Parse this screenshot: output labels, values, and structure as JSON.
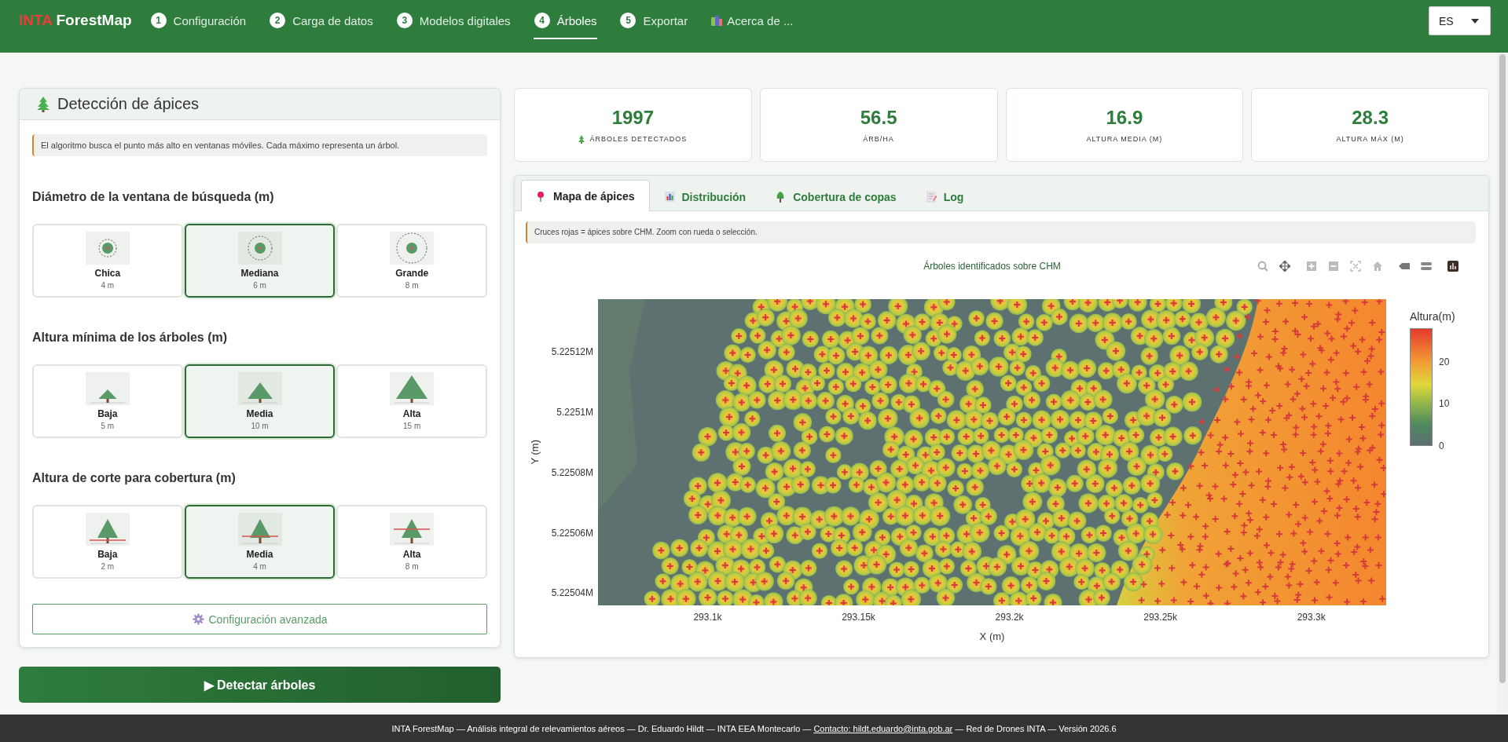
{
  "header": {
    "brand_prefix": "INTA",
    "brand_name": "ForestMap",
    "language": "ES",
    "nav": [
      {
        "kind": "step",
        "number": "1",
        "label": "Configuración",
        "selected": false
      },
      {
        "kind": "step",
        "number": "2",
        "label": "Carga de datos",
        "selected": false
      },
      {
        "kind": "step",
        "number": "3",
        "label": "Modelos digitales",
        "selected": false
      },
      {
        "kind": "step",
        "number": "4",
        "label": "Árboles",
        "selected": true
      },
      {
        "kind": "step",
        "number": "5",
        "label": "Exportar",
        "selected": false
      },
      {
        "kind": "about",
        "label": "Acerca de ...",
        "selected": false
      }
    ]
  },
  "detection_panel": {
    "title": "Detección de ápices",
    "info": "El algoritmo busca el punto más alto en ventanas móviles. Cada máximo representa un árbol.",
    "groups": [
      {
        "title": "Diámetro de la ventana de búsqueda (m)",
        "kind": "window",
        "options": [
          {
            "label": "Chica",
            "value": "4 m",
            "selected": false
          },
          {
            "label": "Mediana",
            "value": "6 m",
            "selected": true
          },
          {
            "label": "Grande",
            "value": "8 m",
            "selected": false
          }
        ]
      },
      {
        "title": "Altura mínima de los árboles (m)",
        "kind": "height",
        "options": [
          {
            "label": "Baja",
            "value": "5 m",
            "selected": false
          },
          {
            "label": "Media",
            "value": "10 m",
            "selected": true
          },
          {
            "label": "Alta",
            "value": "15 m",
            "selected": false
          }
        ]
      },
      {
        "title": "Altura de corte para cobertura (m)",
        "kind": "cut",
        "options": [
          {
            "label": "Baja",
            "value": "2 m",
            "selected": false
          },
          {
            "label": "Media",
            "value": "4 m",
            "selected": true
          },
          {
            "label": "Alta",
            "value": "8 m",
            "selected": false
          }
        ]
      }
    ],
    "advanced_button": "Configuración avanzada"
  },
  "detect_button": "▶ Detectar árboles",
  "stats": [
    {
      "value": "1997",
      "label": "ÁRBOLES DETECTADOS",
      "kind": "tree"
    },
    {
      "value": "56.5",
      "label": "ÁRB/HA",
      "kind": "plain"
    },
    {
      "value": "16.9",
      "label": "ALTURA MEDIA (M)",
      "kind": "plain"
    },
    {
      "value": "28.3",
      "label": "ALTURA MÁX (M)",
      "kind": "plain"
    }
  ],
  "tabs": [
    {
      "label": "Mapa de ápices",
      "kind": "pin",
      "selected": true
    },
    {
      "label": "Distribución",
      "kind": "chart",
      "selected": false
    },
    {
      "label": "Cobertura de copas",
      "kind": "tree",
      "selected": false
    },
    {
      "label": "Log",
      "kind": "memo",
      "selected": false
    }
  ],
  "map": {
    "hint": "Cruces rojas = ápices sobre CHM. Zoom con rueda o selección.",
    "title": "Árboles identificados sobre CHM",
    "xlabel": "X (m)",
    "ylabel": "Y (m)",
    "xticks": [
      "293.1k",
      "293.15k",
      "293.2k",
      "293.25k",
      "293.3k"
    ],
    "yticks": [
      "5.22512M",
      "5.2251M",
      "5.22508M",
      "5.22506M",
      "5.22504M"
    ],
    "colorbar": {
      "title": "Altura(m)",
      "ticks": [
        "20",
        "10",
        "0"
      ]
    }
  },
  "footer": {
    "text_before": "INTA ForestMap — Análisis integral de relevamientos aéreos — Dr. Eduardo Hildt — INTA EEA Montecarlo — ",
    "link": "Contacto: hildt.eduardo@inta.gob.ar",
    "text_after": " — Red de Drones INTA — Versión 2026.6"
  }
}
